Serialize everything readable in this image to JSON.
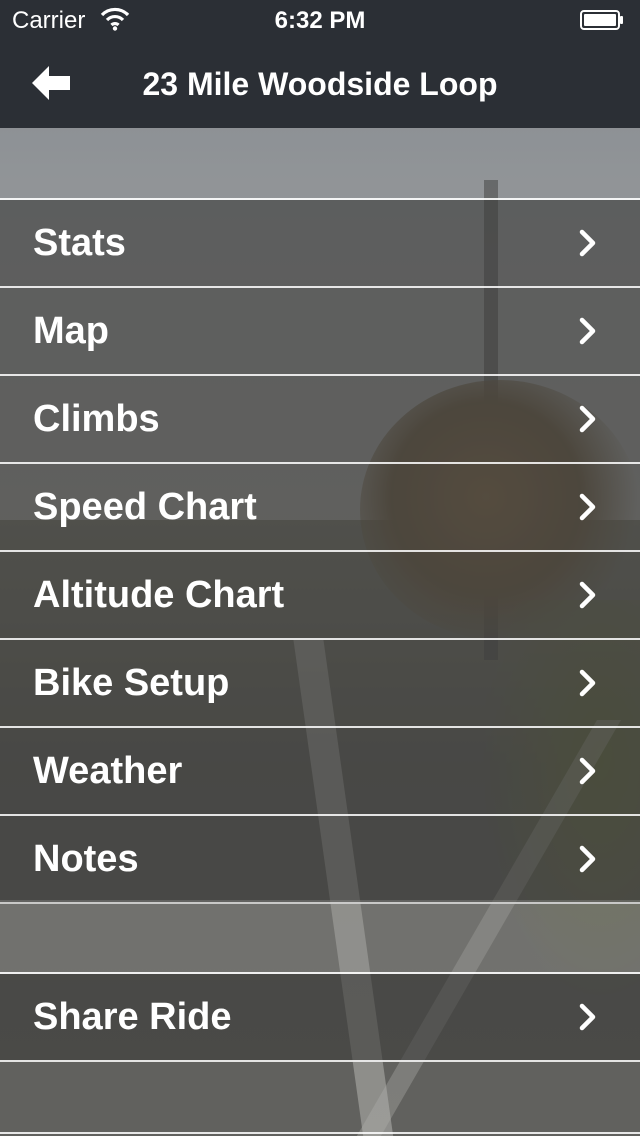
{
  "status_bar": {
    "carrier": "Carrier",
    "time": "6:32 PM",
    "icons": [
      "wifi-icon",
      "battery-icon"
    ]
  },
  "nav": {
    "title": "23 Mile Woodside Loop",
    "back_icon": "back-arrow-icon"
  },
  "menu": {
    "items": [
      {
        "label": "Stats",
        "icon": "chevron-right-icon"
      },
      {
        "label": "Map",
        "icon": "chevron-right-icon"
      },
      {
        "label": "Climbs",
        "icon": "chevron-right-icon"
      },
      {
        "label": "Speed Chart",
        "icon": "chevron-right-icon"
      },
      {
        "label": "Altitude Chart",
        "icon": "chevron-right-icon"
      },
      {
        "label": "Bike Setup",
        "icon": "chevron-right-icon"
      },
      {
        "label": "Weather",
        "icon": "chevron-right-icon"
      },
      {
        "label": "Notes",
        "icon": "chevron-right-icon"
      }
    ],
    "share": {
      "label": "Share Ride",
      "icon": "chevron-right-icon"
    }
  },
  "colors": {
    "nav_bar": "#2b2f35",
    "text": "#ffffff",
    "separator": "#ffffff"
  }
}
